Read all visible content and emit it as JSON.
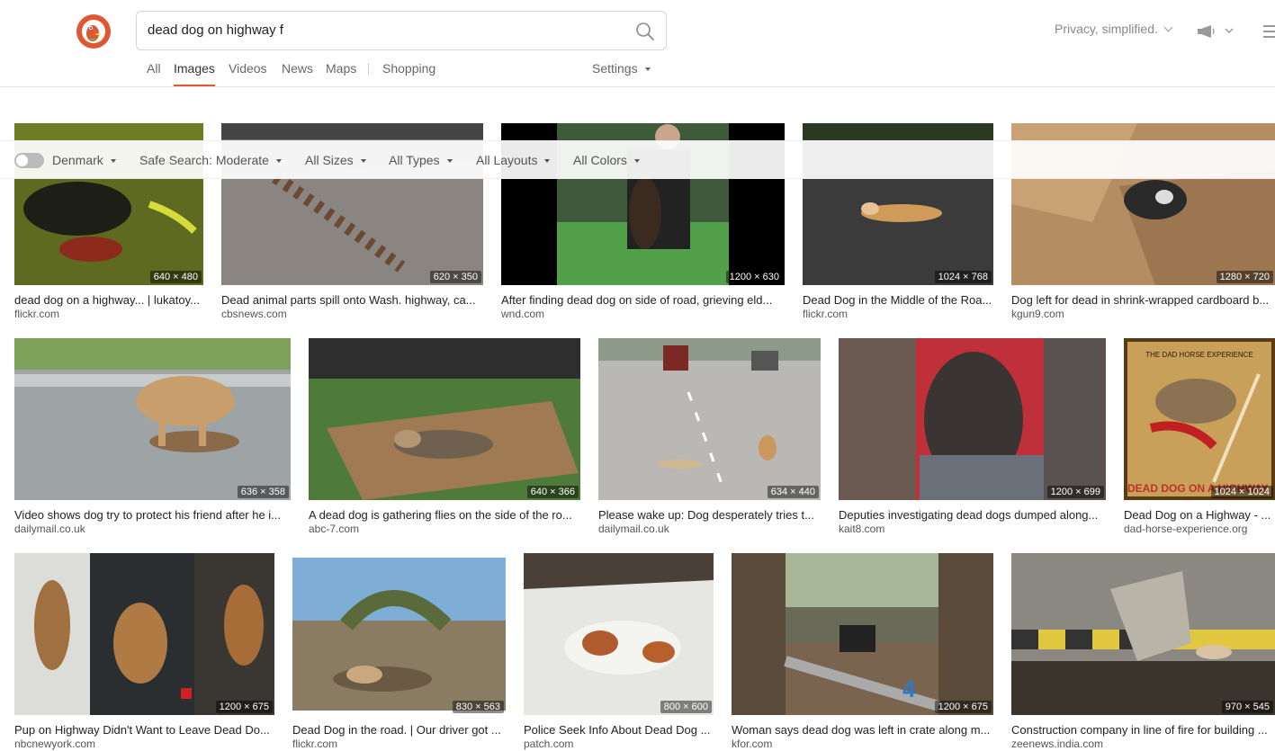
{
  "search": {
    "query": "dead dog on highway f"
  },
  "header": {
    "privacy_label": "Privacy, simplified."
  },
  "tabs": [
    {
      "label": "All"
    },
    {
      "label": "Images"
    },
    {
      "label": "Videos"
    },
    {
      "label": "News"
    },
    {
      "label": "Maps"
    },
    {
      "label": "Shopping"
    }
  ],
  "settings_label": "Settings",
  "filters": {
    "region": "Denmark",
    "safe_search": "Safe Search: Moderate",
    "sizes": "All Sizes",
    "types": "All Types",
    "layouts": "All Layouts",
    "colors": "All Colors"
  },
  "results": [
    {
      "caption": "dead dog on a highway... | lukatoy...",
      "source": "flickr.com",
      "dims": "640 × 480"
    },
    {
      "caption": "Dead animal parts spill onto Wash. highway, ca...",
      "source": "cbsnews.com",
      "dims": "620 × 350"
    },
    {
      "caption": "After finding dead dog on side of road, grieving eld...",
      "source": "wnd.com",
      "dims": "1200 × 630"
    },
    {
      "caption": "Dead Dog in the Middle of the Roa...",
      "source": "flickr.com",
      "dims": "1024 × 768"
    },
    {
      "caption": "Dog left for dead in shrink-wrapped cardboard b...",
      "source": "kgun9.com",
      "dims": "1280 × 720"
    },
    {
      "caption": "Video shows dog try to protect his friend after he i...",
      "source": "dailymail.co.uk",
      "dims": "636 × 358"
    },
    {
      "caption": "A dead dog is gathering flies on the side of the ro...",
      "source": "abc-7.com",
      "dims": "640 × 366"
    },
    {
      "caption": "Please wake up: Dog desperately tries t...",
      "source": "dailymail.co.uk",
      "dims": "634 × 440"
    },
    {
      "caption": "Deputies investigating dead dogs dumped along...",
      "source": "kait8.com",
      "dims": "1200 × 699"
    },
    {
      "caption": "Dead Dog on a Highway - ...",
      "source": "dad-horse-experience.org",
      "dims": "1024 × 1024",
      "thumb_text": "DEAD DOG ON A HIGHWAY",
      "thumb_top_text": "THE DAD HORSE EXPERIENCE"
    },
    {
      "caption": "Pup on Highway Didn't Want to Leave Dead Do...",
      "source": "nbcnewyork.com",
      "dims": "1200 × 675"
    },
    {
      "caption": "Dead Dog in the road. | Our driver got ...",
      "source": "flickr.com",
      "dims": "830 × 563"
    },
    {
      "caption": "Police Seek Info About Dead Dog ...",
      "source": "patch.com",
      "dims": "800 × 600"
    },
    {
      "caption": "Woman says dead dog was left in crate along m...",
      "source": "kfor.com",
      "dims": "1200 × 675"
    },
    {
      "caption": "Construction company in line of fire for building ...",
      "source": "zeenews.india.com",
      "dims": "970 × 545"
    }
  ]
}
